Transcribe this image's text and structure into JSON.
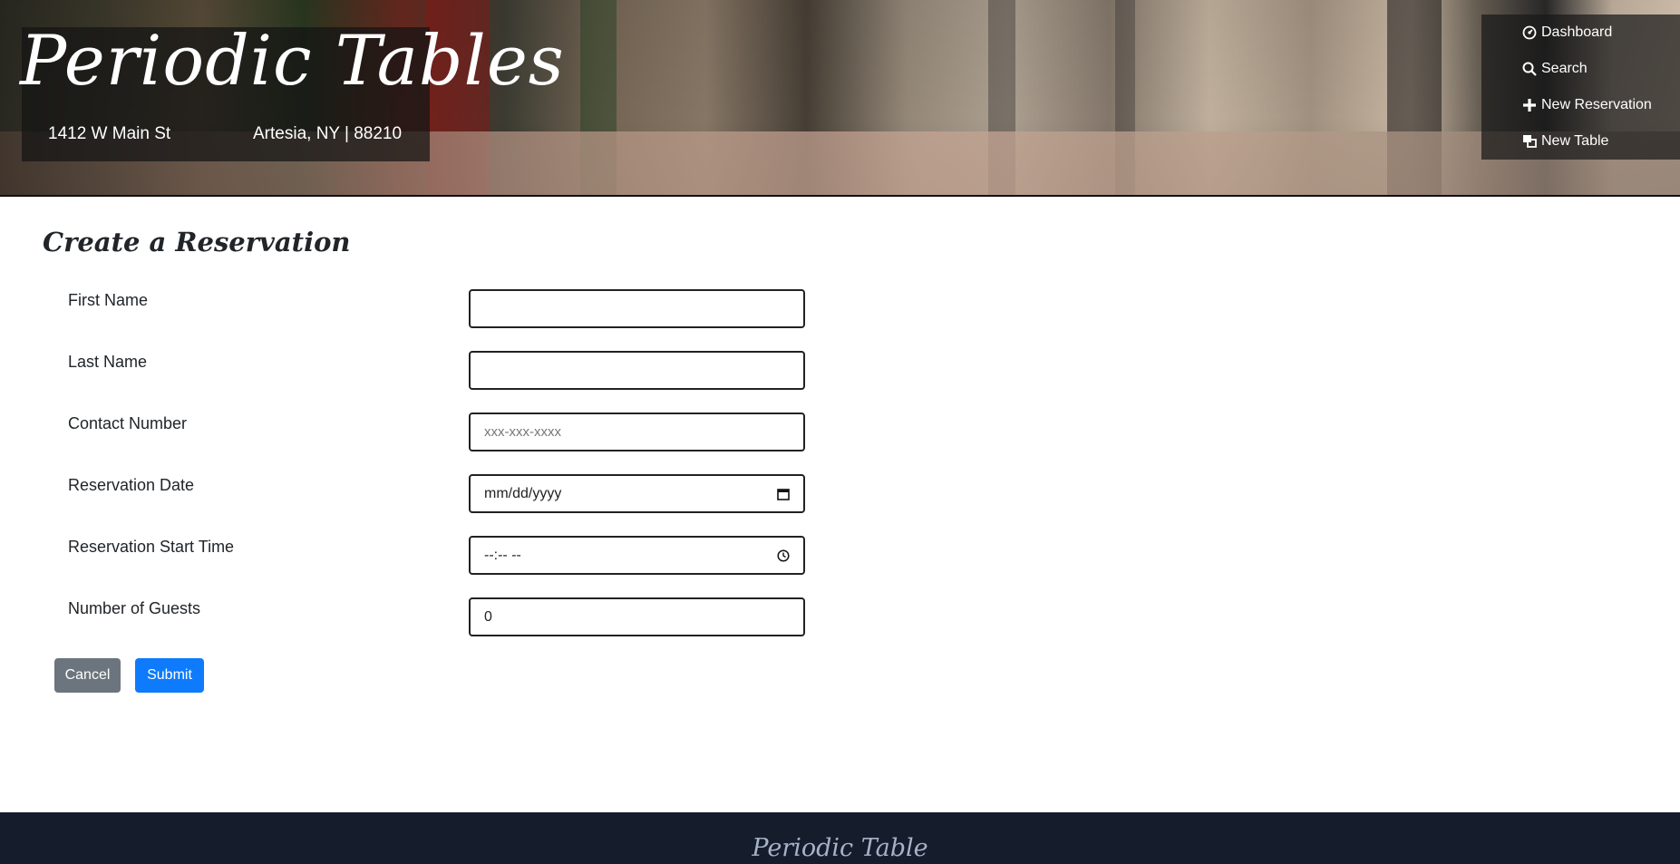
{
  "header": {
    "brand_title": "Periodic Tables",
    "address_street": "1412 W Main St",
    "address_city": "Artesia, NY | 88210"
  },
  "nav": {
    "items": [
      {
        "label": "Dashboard",
        "icon": "dashboard-icon"
      },
      {
        "label": "Search",
        "icon": "search-icon"
      },
      {
        "label": "New Reservation",
        "icon": "plus-icon"
      },
      {
        "label": "New Table",
        "icon": "table-icon"
      }
    ]
  },
  "form": {
    "title": "Create a Reservation",
    "fields": [
      {
        "label": "First Name",
        "value": "",
        "placeholder": ""
      },
      {
        "label": "Last Name",
        "value": "",
        "placeholder": ""
      },
      {
        "label": "Contact Number",
        "value": "",
        "placeholder": "xxx-xxx-xxxx"
      },
      {
        "label": "Reservation Date",
        "value": "mm/dd/yyyy",
        "icon": "calendar-icon"
      },
      {
        "label": "Reservation Start Time",
        "value": "--:-- --",
        "icon": "clock-icon"
      },
      {
        "label": "Number of Guests",
        "value": "0"
      }
    ],
    "cancel_label": "Cancel",
    "submit_label": "Submit"
  },
  "footer": {
    "title": "Periodic Table"
  },
  "colors": {
    "cancel_button": "#6c757d",
    "submit_button": "#0d7bfc",
    "footer_bg": "#151c2c",
    "footer_text": "#a6b2c6"
  }
}
